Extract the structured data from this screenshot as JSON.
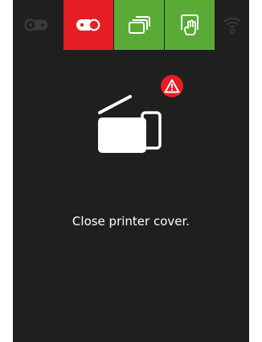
{
  "status_tabs": [
    {
      "name": "ribbon",
      "state": "inactive",
      "color": "#3a3a3a"
    },
    {
      "name": "ink",
      "state": "error",
      "color": "#e61e25"
    },
    {
      "name": "cards",
      "state": "ok",
      "color": "#5aab35"
    },
    {
      "name": "card-handling",
      "state": "ok",
      "color": "#5aab35"
    },
    {
      "name": "wifi",
      "state": "inactive",
      "color": "#3a3a3a"
    }
  ],
  "icons": {
    "ribbon": "ribbon-icon",
    "ink": "ink-ribbon-icon",
    "cards": "cards-stack-icon",
    "card_handling": "hand-card-icon",
    "wifi": "wifi-icon",
    "alert": "warning-icon",
    "printer": "printer-open-cover-icon"
  },
  "colors": {
    "background": "#1f1f1f",
    "error": "#e61e25",
    "ok": "#5aab35",
    "text": "#ffffff"
  },
  "message": "Close printer cover."
}
